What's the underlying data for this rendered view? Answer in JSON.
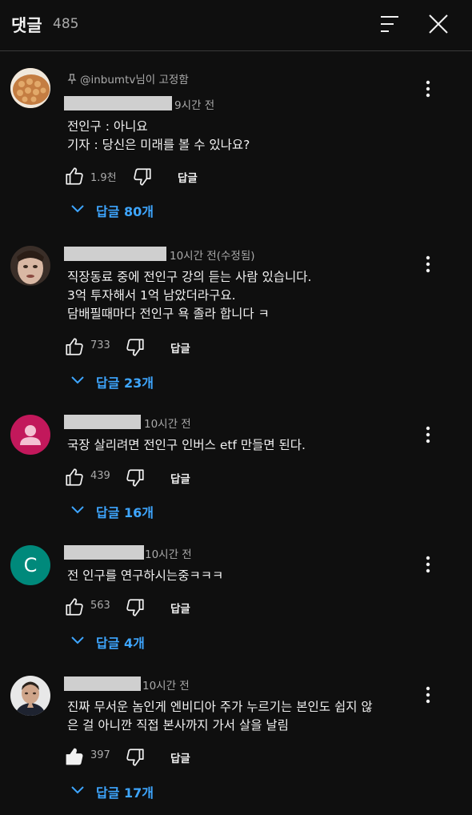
{
  "header": {
    "title": "댓글",
    "count": "485"
  },
  "labels": {
    "reply": "답글"
  },
  "comments": [
    {
      "pinned": "@inbumtv님이 고정함",
      "time": "9시간 전",
      "text": "전인구 : 아니요\n기자 : 당신은 미래를 볼 수 있나요?",
      "likes": "1.9천",
      "replies": "답글 80개"
    },
    {
      "time": "10시간 전(수정됨)",
      "text": "직장동료 중에 전인구 강의 듣는 사람 있습니다.\n3억 투자해서 1억 남았더라구요.\n담배필때마다 전인구 욕 졸라 합니다 ㅋ",
      "likes": "733",
      "replies": "답글 23개"
    },
    {
      "time": "10시간 전",
      "text": "국장 살리려면 전인구 인버스 etf 만들면 된다.",
      "likes": "439",
      "replies": "답글 16개"
    },
    {
      "avatar_letter": "C",
      "time": "10시간 전",
      "text": "전 인구를 연구하시는중ㅋㅋㅋ",
      "likes": "563",
      "replies": "답글 4개"
    },
    {
      "time": "10시간 전",
      "text": "진짜 무서운 놈인게 엔비디아 주가 누르기는 본인도 쉽지 않\n은 걸 아니깐 직접 본사까지 가서 살을 날림",
      "likes": "397",
      "replies": "답글 17개"
    }
  ],
  "colors": {
    "background": "#0f0f0f",
    "link": "#3ea6ff",
    "muted": "#aaaaaa",
    "avatar_pink": "#c2185b",
    "avatar_teal": "#00897b"
  },
  "icons": [
    "sort-icon",
    "close-icon",
    "pin-icon",
    "more-vert-icon",
    "thumb-up-icon",
    "thumb-down-icon",
    "chevron-down-icon"
  ]
}
